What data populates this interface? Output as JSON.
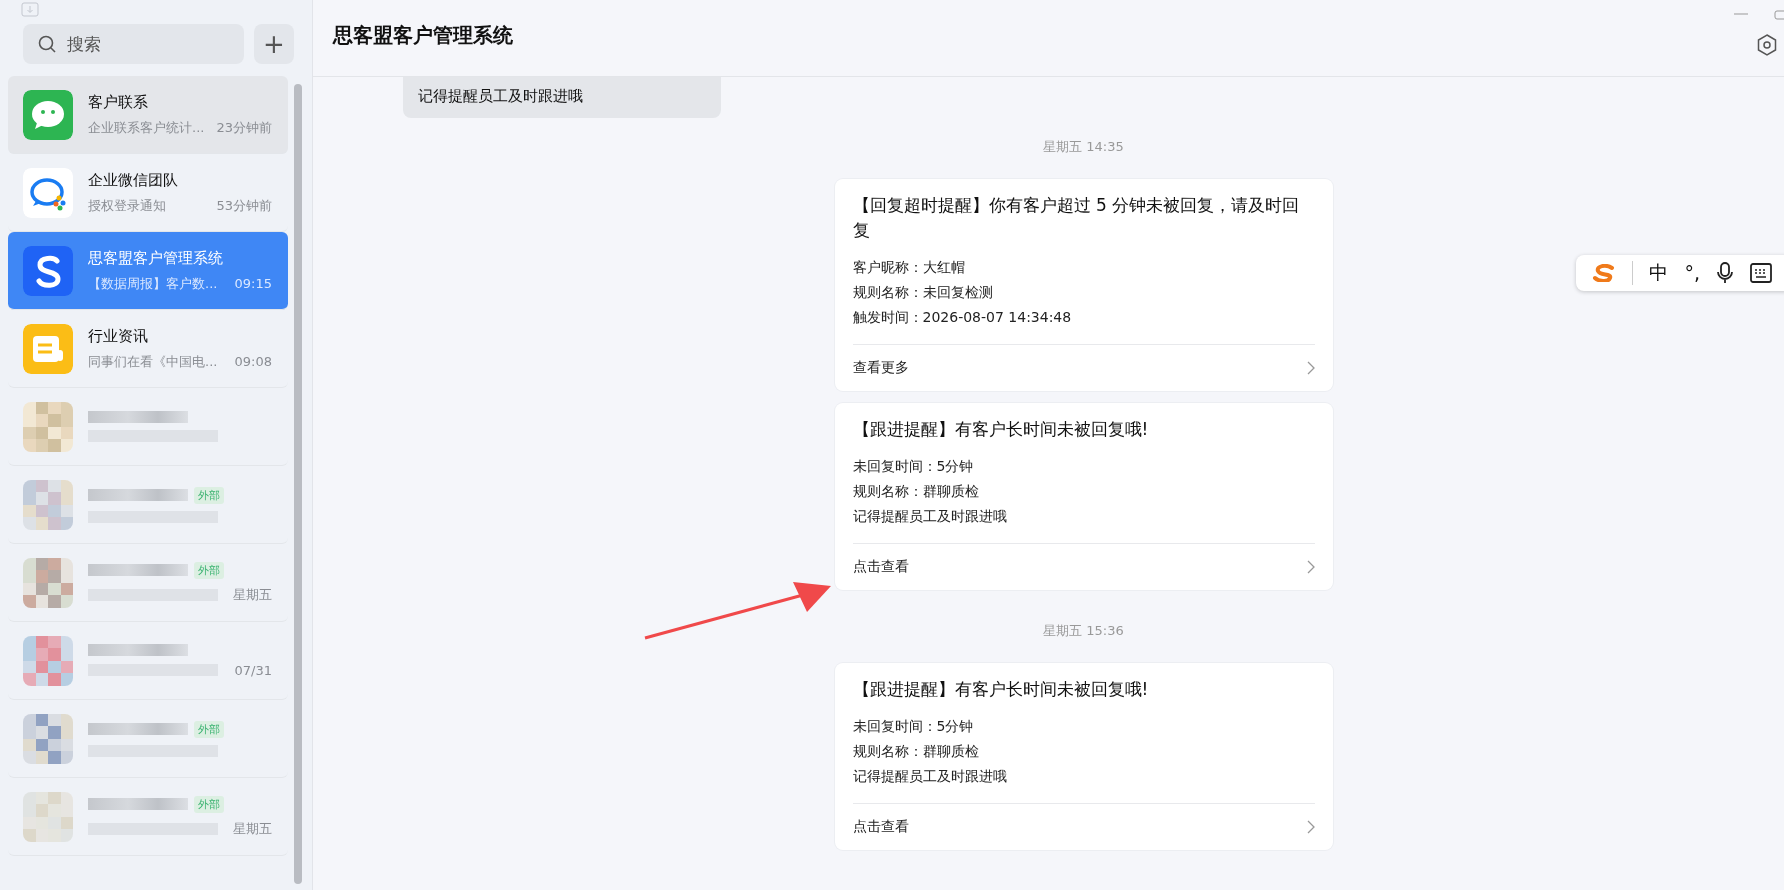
{
  "sidebar": {
    "search": {
      "placeholder": "搜索"
    },
    "add_button": "+",
    "chats": [
      {
        "kind": "wechat",
        "name": "客户联系",
        "preview": "企业联系客户统计...",
        "time": "23分钟前",
        "selected": false,
        "hover": true
      },
      {
        "kind": "wecom",
        "name": "企业微信团队",
        "preview": "授权登录通知",
        "time": "53分钟前",
        "selected": false,
        "hover": false
      },
      {
        "kind": "s-logo",
        "name": "思客盟客户管理系统",
        "preview": "【数据周报】客户数...",
        "time": "09:15",
        "selected": true,
        "hover": false
      },
      {
        "kind": "news",
        "name": "行业资讯",
        "preview": "同事们在看《中国电...",
        "time": "09:08",
        "selected": false,
        "hover": false
      },
      {
        "kind": "blurred",
        "selected": false,
        "hover": false
      },
      {
        "kind": "blurred",
        "tag": "外部",
        "selected": false,
        "hover": false
      },
      {
        "kind": "blurred",
        "tag": "外部",
        "time": "星期五",
        "selected": false,
        "hover": false
      },
      {
        "kind": "blurred",
        "time": "07/31",
        "selected": false,
        "hover": false
      },
      {
        "kind": "blurred",
        "tag": "外部",
        "selected": false,
        "hover": false
      },
      {
        "kind": "blurred",
        "tag": "外部",
        "time": "星期五",
        "selected": false,
        "hover": false
      }
    ]
  },
  "header": {
    "title": "思客盟客户管理系统"
  },
  "messages": [
    {
      "kind": "bubble",
      "text": "记得提醒员工及时跟进哦"
    },
    {
      "kind": "time",
      "text": "星期五 14:35"
    },
    {
      "kind": "card",
      "title": "【回复超时提醒】你有客户超过 5 分钟未被回复，请及时回复",
      "lines": [
        "客户昵称：大红帽",
        "规则名称：未回复检测",
        "触发时间：2026-08-07 14:34:48"
      ],
      "link": "查看更多"
    },
    {
      "kind": "card",
      "title": "【跟进提醒】有客户长时间未被回复哦!",
      "lines": [
        "未回复时间：5分钟",
        "规则名称：群聊质检",
        "记得提醒员工及时跟进哦"
      ],
      "link": "点击查看"
    },
    {
      "kind": "time",
      "text": "星期五 15:36"
    },
    {
      "kind": "card",
      "title": "【跟进提醒】有客户长时间未被回复哦!",
      "lines": [
        "未回复时间：5分钟",
        "规则名称：群聊质检",
        "记得提醒员工及时跟进哦"
      ],
      "link": "点击查看"
    }
  ],
  "ime_toolbar": {
    "mode": "中",
    "punct": "°,"
  }
}
